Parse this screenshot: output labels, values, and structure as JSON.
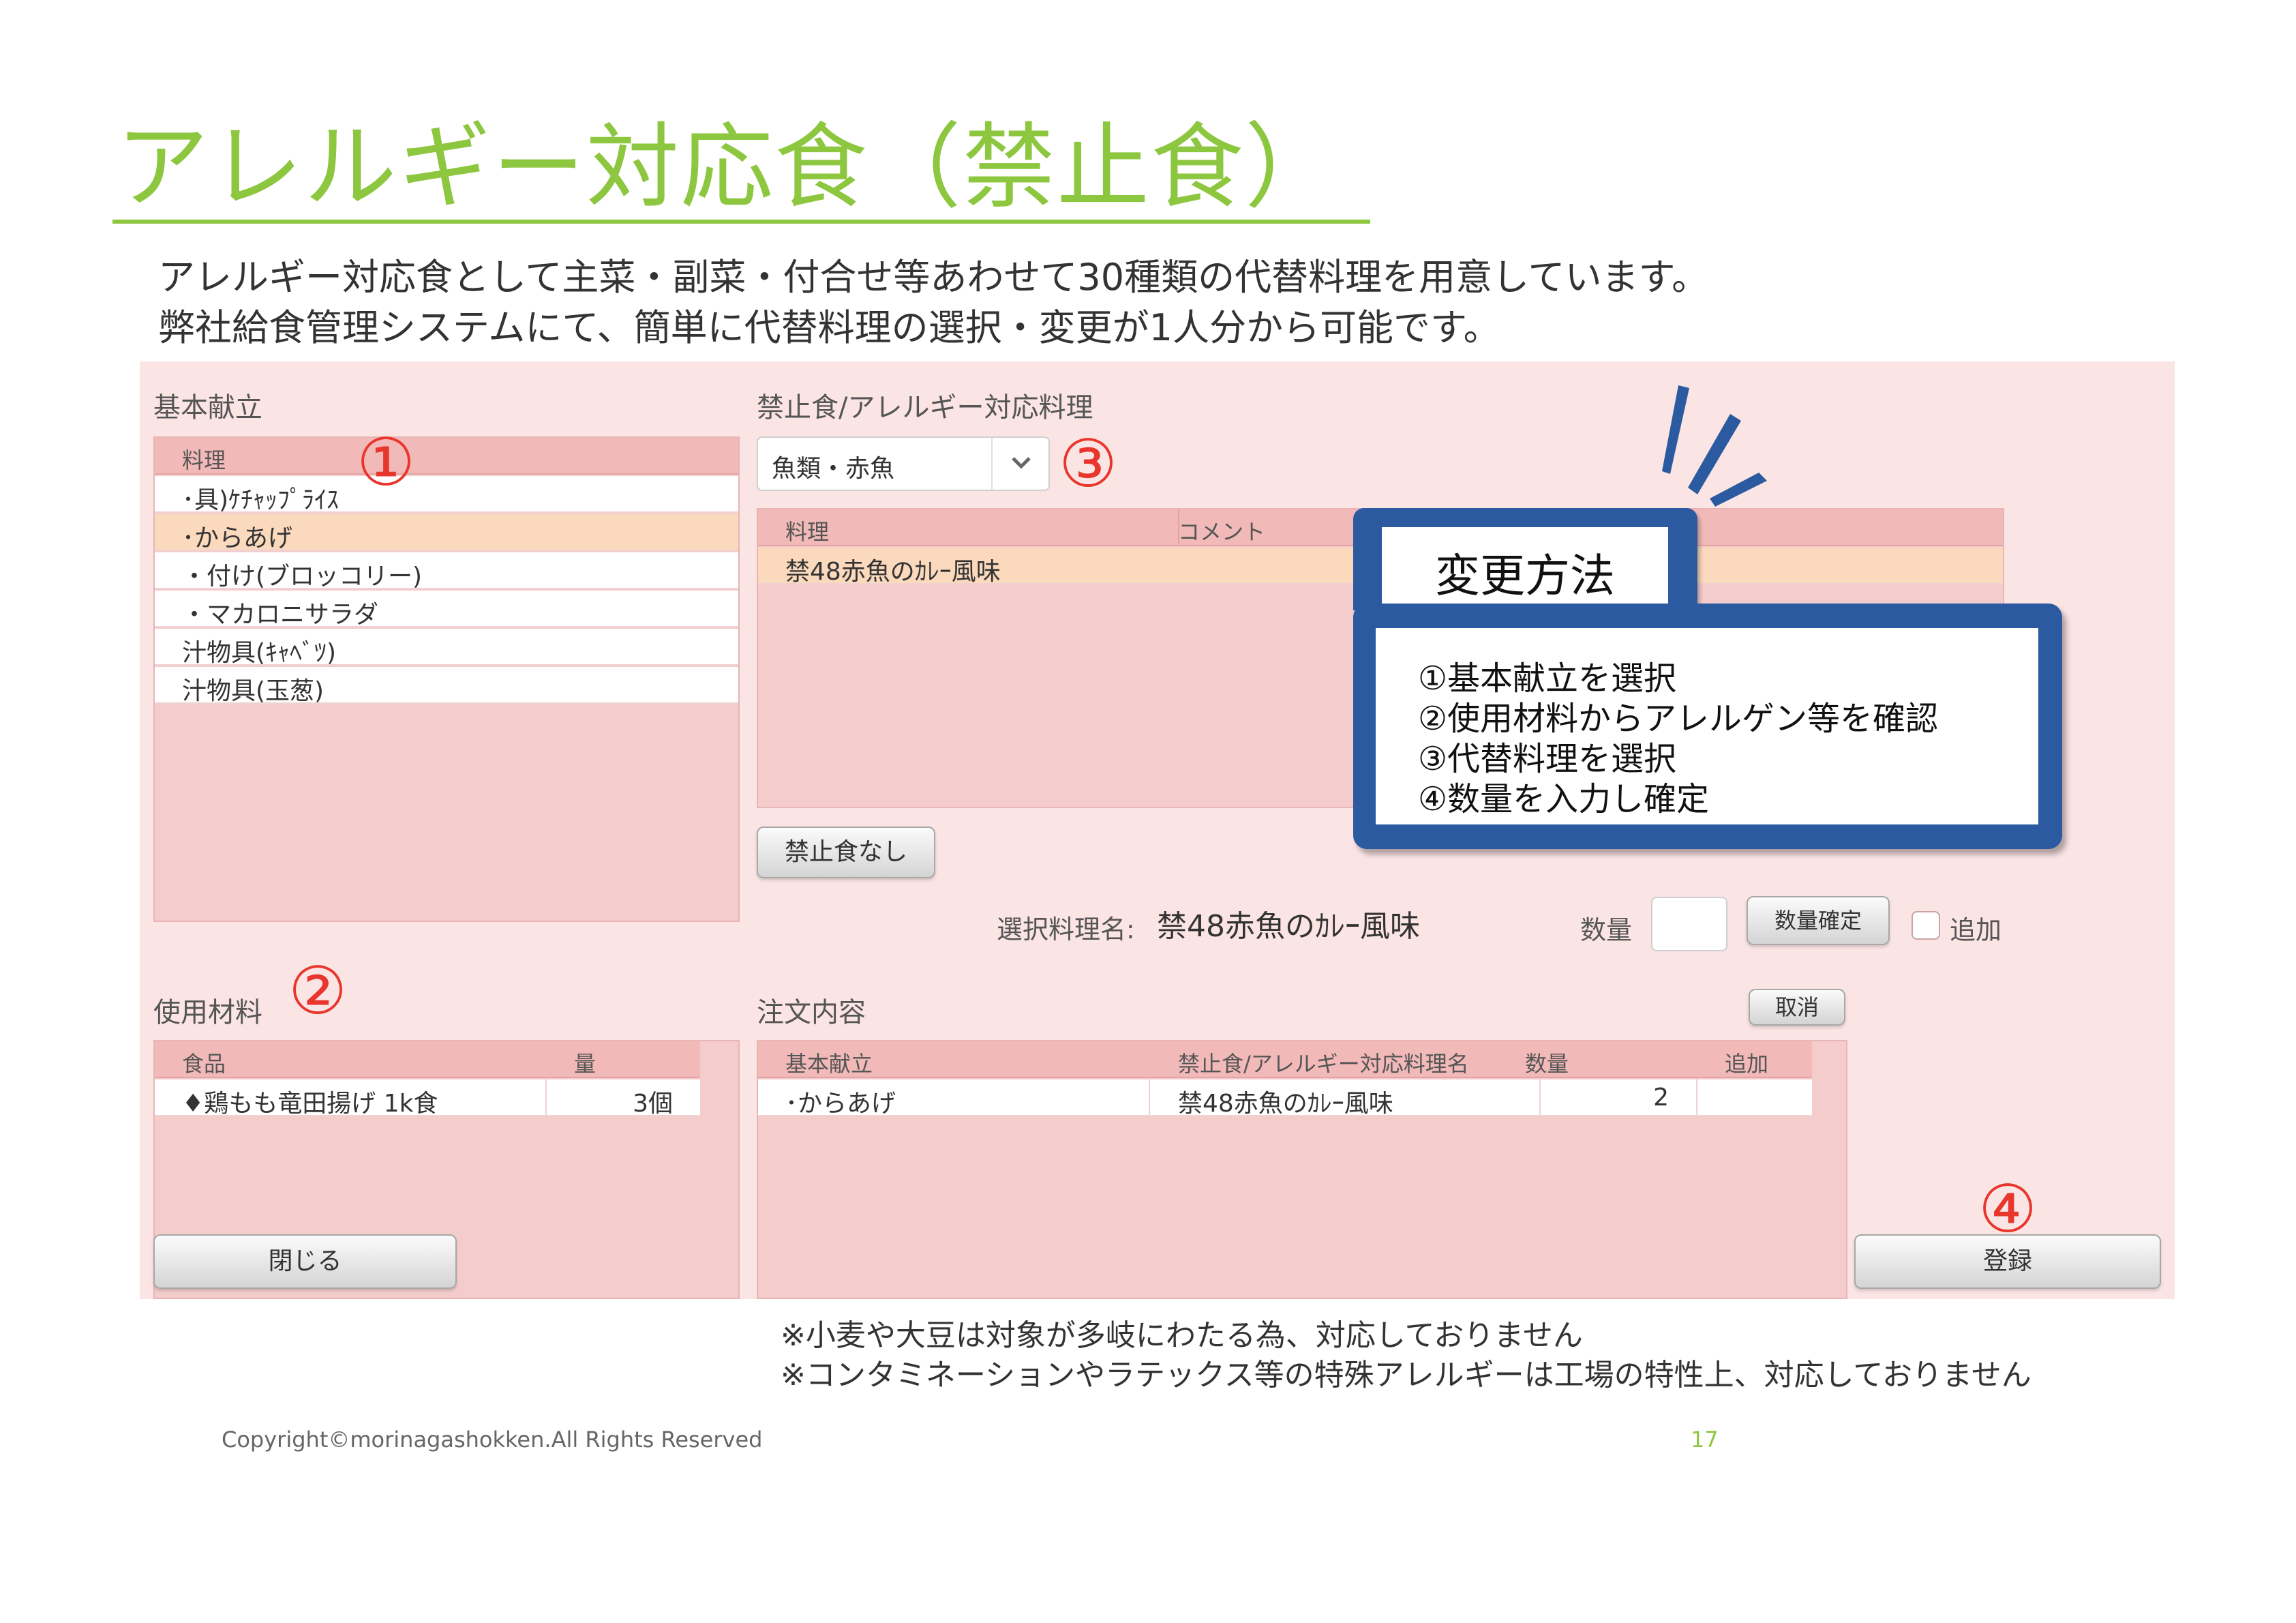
{
  "slide": {
    "title": "アレルギー対応食（禁止食）",
    "intro_line1": "アレルギー対応食として主菜・副菜・付合せ等あわせて30種類の代替料理を用意しています。",
    "intro_line2": "弊社給食管理システムにて、簡単に代替料理の選択・変更が1人分から可能です。"
  },
  "colors": {
    "title_green": "#8dc63f",
    "panel_pink": "#fbe4e4",
    "selected_row": "#fbd9bd",
    "step_red": "#e8362d",
    "callout_blue": "#2c5aa0"
  },
  "basic_menu": {
    "label": "基本献立",
    "column_header": "料理",
    "step_marker": "①",
    "items": [
      {
        "text": "･具)ｹﾁｬｯﾌﾟﾗｲｽ",
        "selected": false
      },
      {
        "text": "･からあげ",
        "selected": true
      },
      {
        "text": " ・付け(ブロッコリー)",
        "selected": false
      },
      {
        "text": " ・マカロニサラダ",
        "selected": false
      },
      {
        "text": "汁物具(ｷｬﾍﾞﾂ)",
        "selected": false
      },
      {
        "text": "汁物具(玉葱)",
        "selected": false
      }
    ]
  },
  "materials": {
    "label": "使用材料",
    "step_marker": "②",
    "columns": [
      "食品",
      "量"
    ],
    "rows": [
      {
        "food": "♦鶏もも竜田揚げ 1k食",
        "qty": "3個"
      }
    ],
    "close_button": "閉じる"
  },
  "alt_dishes": {
    "label": "禁止食/アレルギー対応料理",
    "step_marker": "③",
    "dropdown_value": "魚類・赤魚",
    "dropdown_icon": "chevron-down-icon",
    "columns": [
      "料理",
      "コメント"
    ],
    "rows": [
      {
        "dish": "禁48赤魚のｶﾚｰ風味",
        "comment": ""
      }
    ],
    "no_restriction_button": "禁止食なし"
  },
  "selection": {
    "selected_label": "選択料理名:",
    "selected_value": "禁48赤魚のｶﾚｰ風味",
    "qty_label": "数量",
    "qty_value": "",
    "confirm_button": "数量確定",
    "add_label": "追加",
    "add_checked": false
  },
  "order": {
    "label": "注文内容",
    "cancel_button": "取消",
    "columns": [
      "基本献立",
      "禁止食/アレルギー対応料理名",
      "数量",
      "追加"
    ],
    "rows": [
      {
        "base": "･からあげ",
        "alt": "禁48赤魚のｶﾚｰ風味",
        "qty": "2",
        "add": ""
      }
    ],
    "step_marker": "④",
    "register_button": "登録"
  },
  "callout": {
    "title": "変更方法",
    "steps": [
      "①基本献立を選択",
      "②使用材料からアレルゲン等を確認",
      "③代替料理を選択",
      "④数量を入力し確定"
    ]
  },
  "notes": [
    "※小麦や大豆は対象が多岐にわたる為、対応しておりません",
    "※コンタミネーションやラテックス等の特殊アレルギーは工場の特性上、対応しておりません"
  ],
  "footer": {
    "copyright": "Copyright©morinagashokken.All Rights Reserved",
    "page_number": "17"
  }
}
